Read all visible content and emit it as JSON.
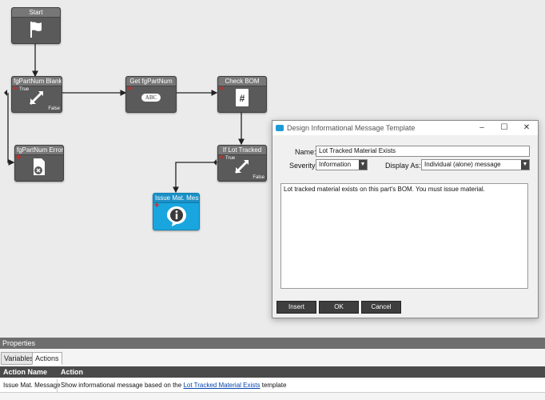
{
  "workflow": {
    "nodes": {
      "start": {
        "title": "Start"
      },
      "fgpartnum_blank": {
        "title": "fgPartNum Blank",
        "true_label": "True",
        "false_label": "False"
      },
      "get_fgpartnum": {
        "title": "Get fgPartNum",
        "icon_text": "ABC"
      },
      "check_bom": {
        "title": "Check BOM",
        "icon_text": "#"
      },
      "fgpartnum_error": {
        "title": "fgPartNum Error"
      },
      "if_lot_tracked": {
        "title": "If Lot Tracked",
        "true_label": "True",
        "false_label": "False"
      },
      "issue_mat_message": {
        "title": "Issue Mat. Messag"
      }
    }
  },
  "dialog": {
    "title": "Design Informational Message Template",
    "name_label": "Name:",
    "name_value": "Lot Tracked Material Exists",
    "severity_label": "Severity:",
    "severity_value": "Information",
    "display_as_label": "Display As:",
    "display_as_value": "Individual (alone) message",
    "message_text": "Lot tracked material exists on this part's BOM. You must issue material.",
    "buttons": {
      "insert": "Insert",
      "ok": "OK",
      "cancel": "Cancel"
    }
  },
  "properties": {
    "header": "Properties",
    "tabs": [
      {
        "label": "Variables"
      },
      {
        "label": "Actions"
      }
    ],
    "table": {
      "columns": [
        "Action Name",
        "Action"
      ],
      "row": {
        "action_name": "Issue Mat. Message",
        "action_prefix": "Show informational message based on the",
        "action_link": "Lot Tracked Material Exists",
        "action_suffix": "template"
      }
    }
  },
  "colors": {
    "node_gray": "#5a5a5a",
    "node_blue": "#19a6df",
    "accent_red": "#e0201c",
    "link": "#0645ad"
  }
}
